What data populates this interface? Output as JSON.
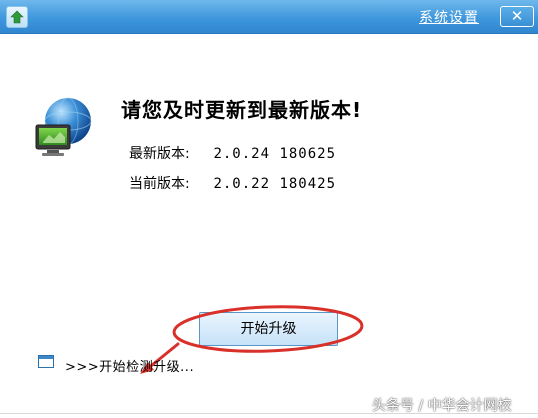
{
  "window": {
    "settings_link": "系统设置",
    "close_label": "✕"
  },
  "content": {
    "heading": "请您及时更新到最新版本!",
    "latest_label": "最新版本:",
    "latest_value": "2.0.24 180625",
    "current_label": "当前版本:",
    "current_value": "2.0.22 180425"
  },
  "actions": {
    "start_upgrade": "开始升级"
  },
  "status": {
    "text": ">>>开始检测升级..."
  },
  "watermark": "头条号 / 中华会计网校",
  "colors": {
    "titlebar": "#3f97dc",
    "button_bg": "#c6e2f8",
    "annotation": "#d9302a"
  },
  "icons": {
    "app": "app-logo-icon",
    "globe": "globe-monitor-icon",
    "status": "window-icon"
  }
}
